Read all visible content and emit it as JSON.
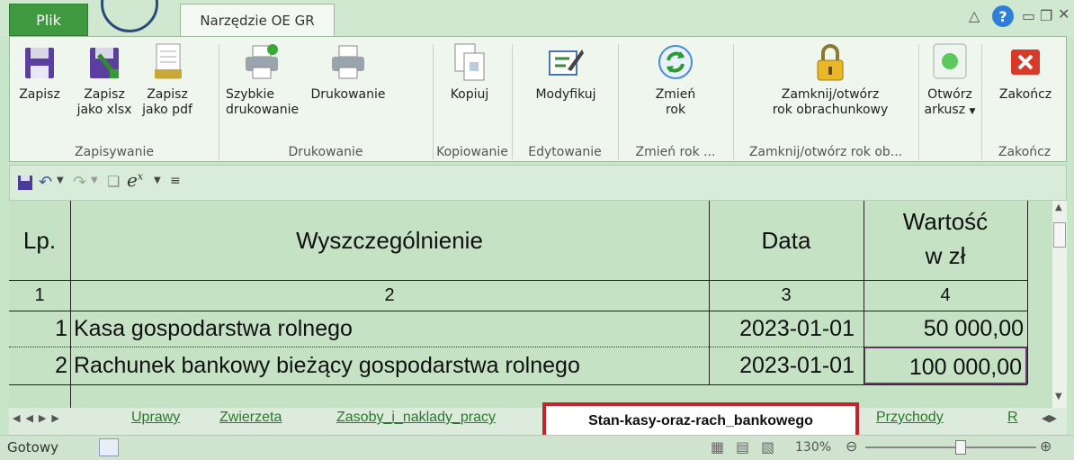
{
  "tabs": {
    "file": "Plik",
    "tool": "Narzędzie OE GR"
  },
  "ribbon": {
    "buttons": [
      {
        "label": "Zapisz",
        "icon": "save-icon"
      },
      {
        "label": "Zapisz\njako xlsx",
        "icon": "save-xlsx-icon"
      },
      {
        "label": "Zapisz\njako pdf",
        "icon": "save-pdf-icon"
      },
      {
        "label": "Szybkie\ndrukowanie",
        "icon": "quick-print-icon"
      },
      {
        "label": "Drukowanie",
        "icon": "print-icon"
      },
      {
        "label": "Kopiuj",
        "icon": "copy-icon"
      },
      {
        "label": "Modyfikuj",
        "icon": "edit-icon"
      },
      {
        "label": "Zmień\nrok",
        "icon": "refresh-icon"
      },
      {
        "label": "Zamknij/otwórz\nrok obrachunkowy",
        "icon": "lock-icon"
      },
      {
        "label": "Otwórz\narkusz",
        "icon": "open-sheet-icon"
      },
      {
        "label": "Zakończ",
        "icon": "close-red-icon"
      }
    ],
    "groups": [
      "Zapisywanie",
      "Drukowanie",
      "Kopiowanie",
      "Edytowanie",
      "Zmień rok ...",
      "Zamknij/otwórz rok ob...",
      "Zakończ"
    ]
  },
  "table": {
    "headers": {
      "lp": "Lp.",
      "desc": "Wyszczególnienie",
      "date": "Data",
      "value_line1": "Wartość",
      "value_line2": "w zł"
    },
    "colnums": [
      "1",
      "2",
      "3",
      "4"
    ],
    "rows": [
      {
        "lp": "1",
        "desc": "Kasa gospodarstwa rolnego",
        "date": "2023-01-01",
        "value": "50 000,00"
      },
      {
        "lp": "2",
        "desc": "Rachunek bankowy bieżący gospodarstwa rolnego",
        "date": "2023-01-01",
        "value": "100 000,00"
      }
    ]
  },
  "sheet_tabs": [
    "Uprawy",
    "Zwierzeta",
    "Zasoby_i_naklady_pracy",
    "Stan-kasy-oraz-rach_bankowego",
    "Przychody",
    "R"
  ],
  "status": {
    "ready": "Gotowy",
    "zoom": "130%"
  },
  "colors": {
    "highlight_box": "#c0262c",
    "accent": "#3f9a3f"
  }
}
